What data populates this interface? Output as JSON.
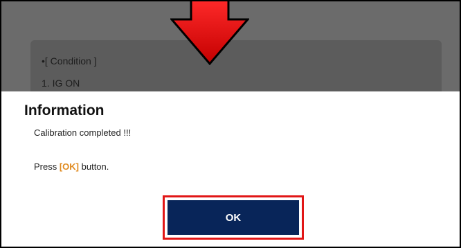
{
  "background": {
    "condition_header": "•[ Condition ]",
    "condition_item": "1. IG ON"
  },
  "dialog": {
    "title": "Information",
    "message": "Calibration completed !!!",
    "press_prefix": "Press ",
    "press_highlight": "[OK]",
    "press_suffix": " button.",
    "ok_label": "OK"
  },
  "colors": {
    "ok_button": "#082559",
    "highlight": "#e08a1e",
    "callout_red": "#e11616"
  },
  "icons": {
    "pointer_arrow": "arrow-down-icon"
  }
}
